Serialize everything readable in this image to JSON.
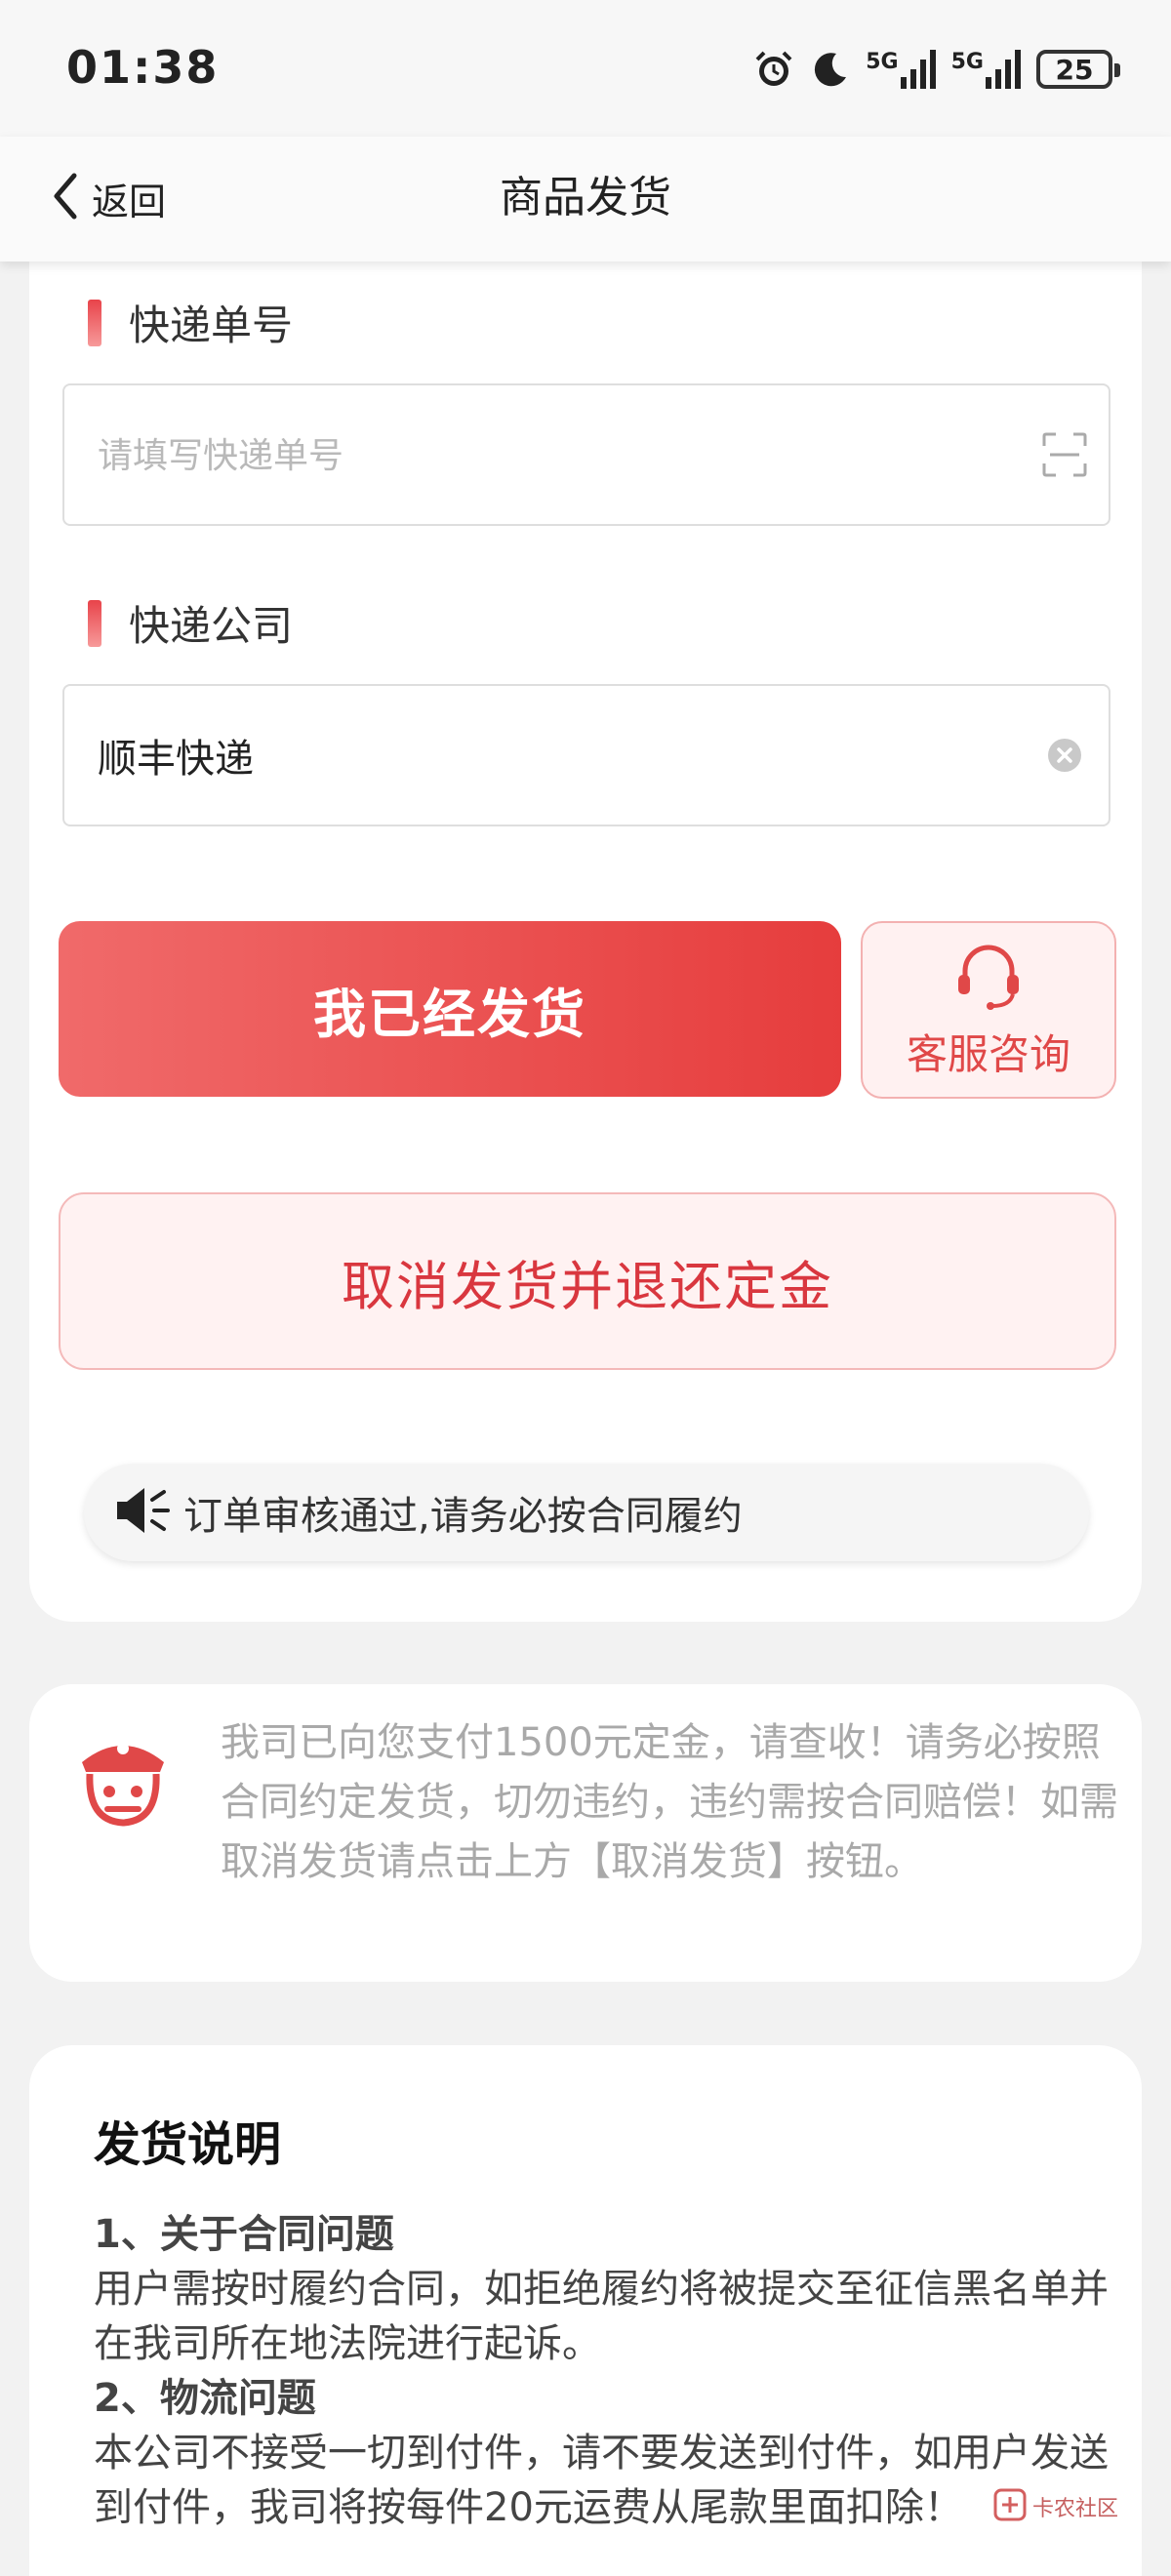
{
  "status_bar": {
    "time": "01:38",
    "signal_1": "5G",
    "signal_2": "5G",
    "battery": "25",
    "icons": [
      "alarm-icon",
      "moon-icon",
      "signal-icon",
      "battery-icon"
    ]
  },
  "nav": {
    "back_label": "返回",
    "title": "商品发货"
  },
  "form": {
    "tracking_label": "快递单号",
    "tracking_placeholder": "请填写快递单号",
    "tracking_value": "",
    "courier_label": "快递公司",
    "courier_value": "顺丰快递"
  },
  "actions": {
    "shipped_label": "我已经发货",
    "service_label": "客服咨询",
    "cancel_label": "取消发货并退还定金"
  },
  "ticker": {
    "text": "订单审核通过,请务必按合同履约"
  },
  "notice": {
    "text": "我司已向您支付1500元定金，请查收！请务必按照合同约定发货，切勿违约，违约需按合同赔偿！如需取消发货请点击上方【取消发货】按钮。"
  },
  "rules": {
    "title": "发货说明",
    "items": [
      {
        "head": "1、关于合同问题",
        "text": "用户需按时履约合同，如拒绝履约将被提交至征信黑名单并在我司所在地法院进行起诉。"
      },
      {
        "head": "2、物流问题",
        "text": "本公司不接受一切到付件，请不要发送到付件，如用户发送到付件，我司将按每件20元运费从尾款里面扣除！"
      }
    ]
  },
  "watermark": {
    "text": "卡农社区"
  },
  "colors": {
    "accent": "#e63d3d",
    "accent_light": "#fff2f2",
    "muted_text": "#a9a9a9"
  }
}
